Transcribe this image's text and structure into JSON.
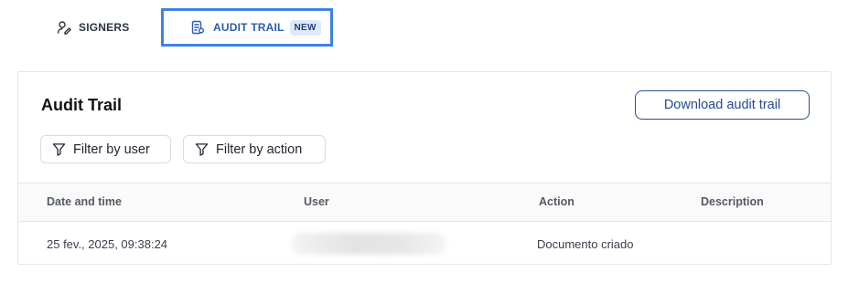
{
  "tabs": {
    "signers": {
      "label": "SIGNERS",
      "icon": "signers-icon"
    },
    "audit_trail": {
      "label": "AUDIT TRAIL",
      "badge": "NEW",
      "icon": "document-icon"
    }
  },
  "panel": {
    "title": "Audit Trail",
    "download_label": "Download audit trail",
    "filters": {
      "by_user": "Filter by user",
      "by_action": "Filter by action"
    }
  },
  "table": {
    "headers": {
      "date": "Date and time",
      "user": "User",
      "action": "Action",
      "description": "Description"
    },
    "rows": [
      {
        "date": "25 fev., 2025, 09:38:24",
        "user": "",
        "action": "Documento criado",
        "description": ""
      }
    ]
  },
  "colors": {
    "accent": "#2e5ab0",
    "active_tab_border": "#3f82e3"
  }
}
